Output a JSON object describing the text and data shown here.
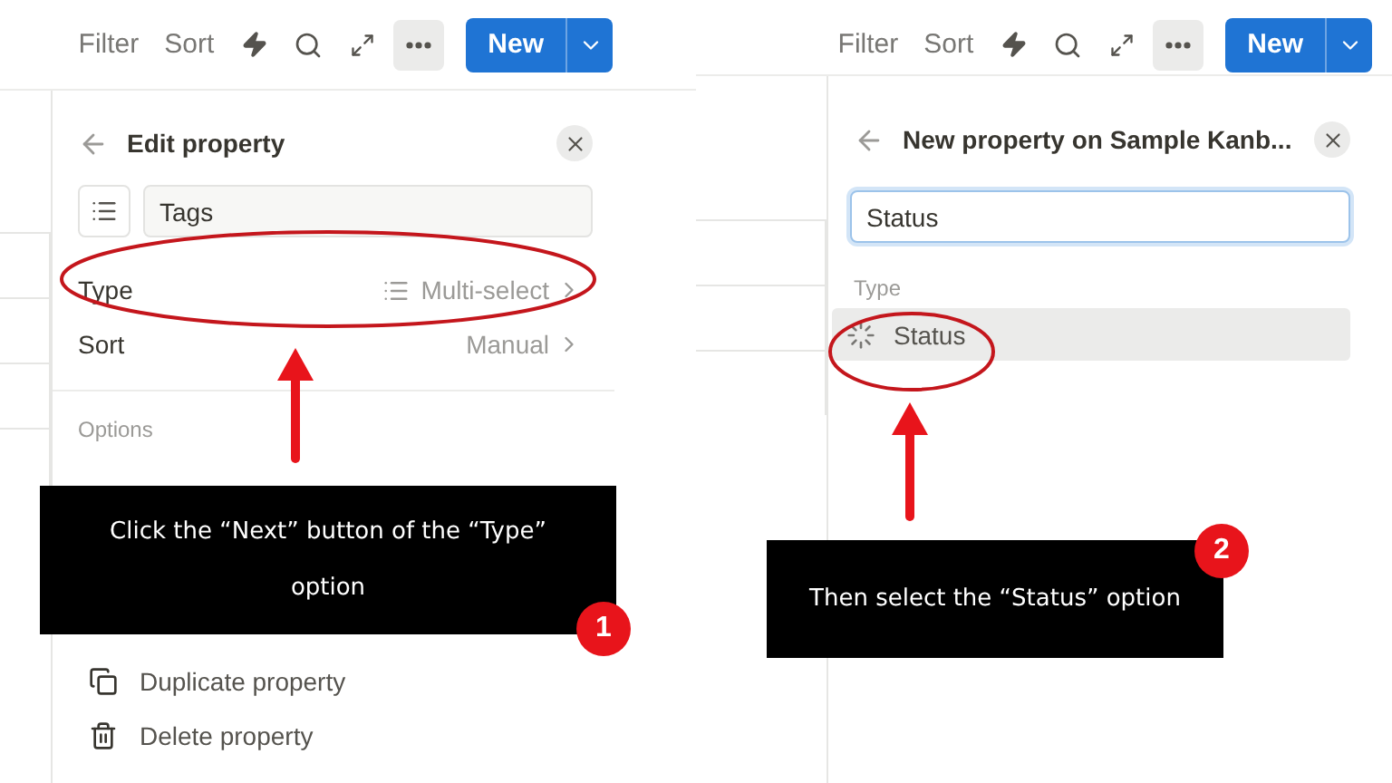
{
  "edit_panel": {
    "toolbar": {
      "filter": "Filter",
      "sort": "Sort",
      "new": "New"
    },
    "title": "Edit property",
    "name_field": {
      "value": "Tags"
    },
    "rows": [
      {
        "label": "Type",
        "value": "Multi-select",
        "kind": "type"
      },
      {
        "label": "Sort",
        "value": "Manual",
        "kind": "plain"
      }
    ],
    "section": "Options",
    "actions": [
      {
        "label": "Duplicate property",
        "kind": "duplicate"
      },
      {
        "label": "Delete property",
        "kind": "delete"
      }
    ],
    "callout": {
      "text": "Click the “Next” button of the “Type” option",
      "step": "1"
    }
  },
  "new_panel": {
    "toolbar": {
      "filter": "Filter",
      "sort": "Sort",
      "new": "New"
    },
    "title": "New property on Sample Kanb...",
    "name_field": {
      "value": "Status",
      "focused": true
    },
    "type_label": "Type",
    "options": [
      {
        "label": "Status",
        "selected": true
      }
    ],
    "callout": {
      "text": "Then select the “Status” option",
      "step": "2"
    }
  }
}
